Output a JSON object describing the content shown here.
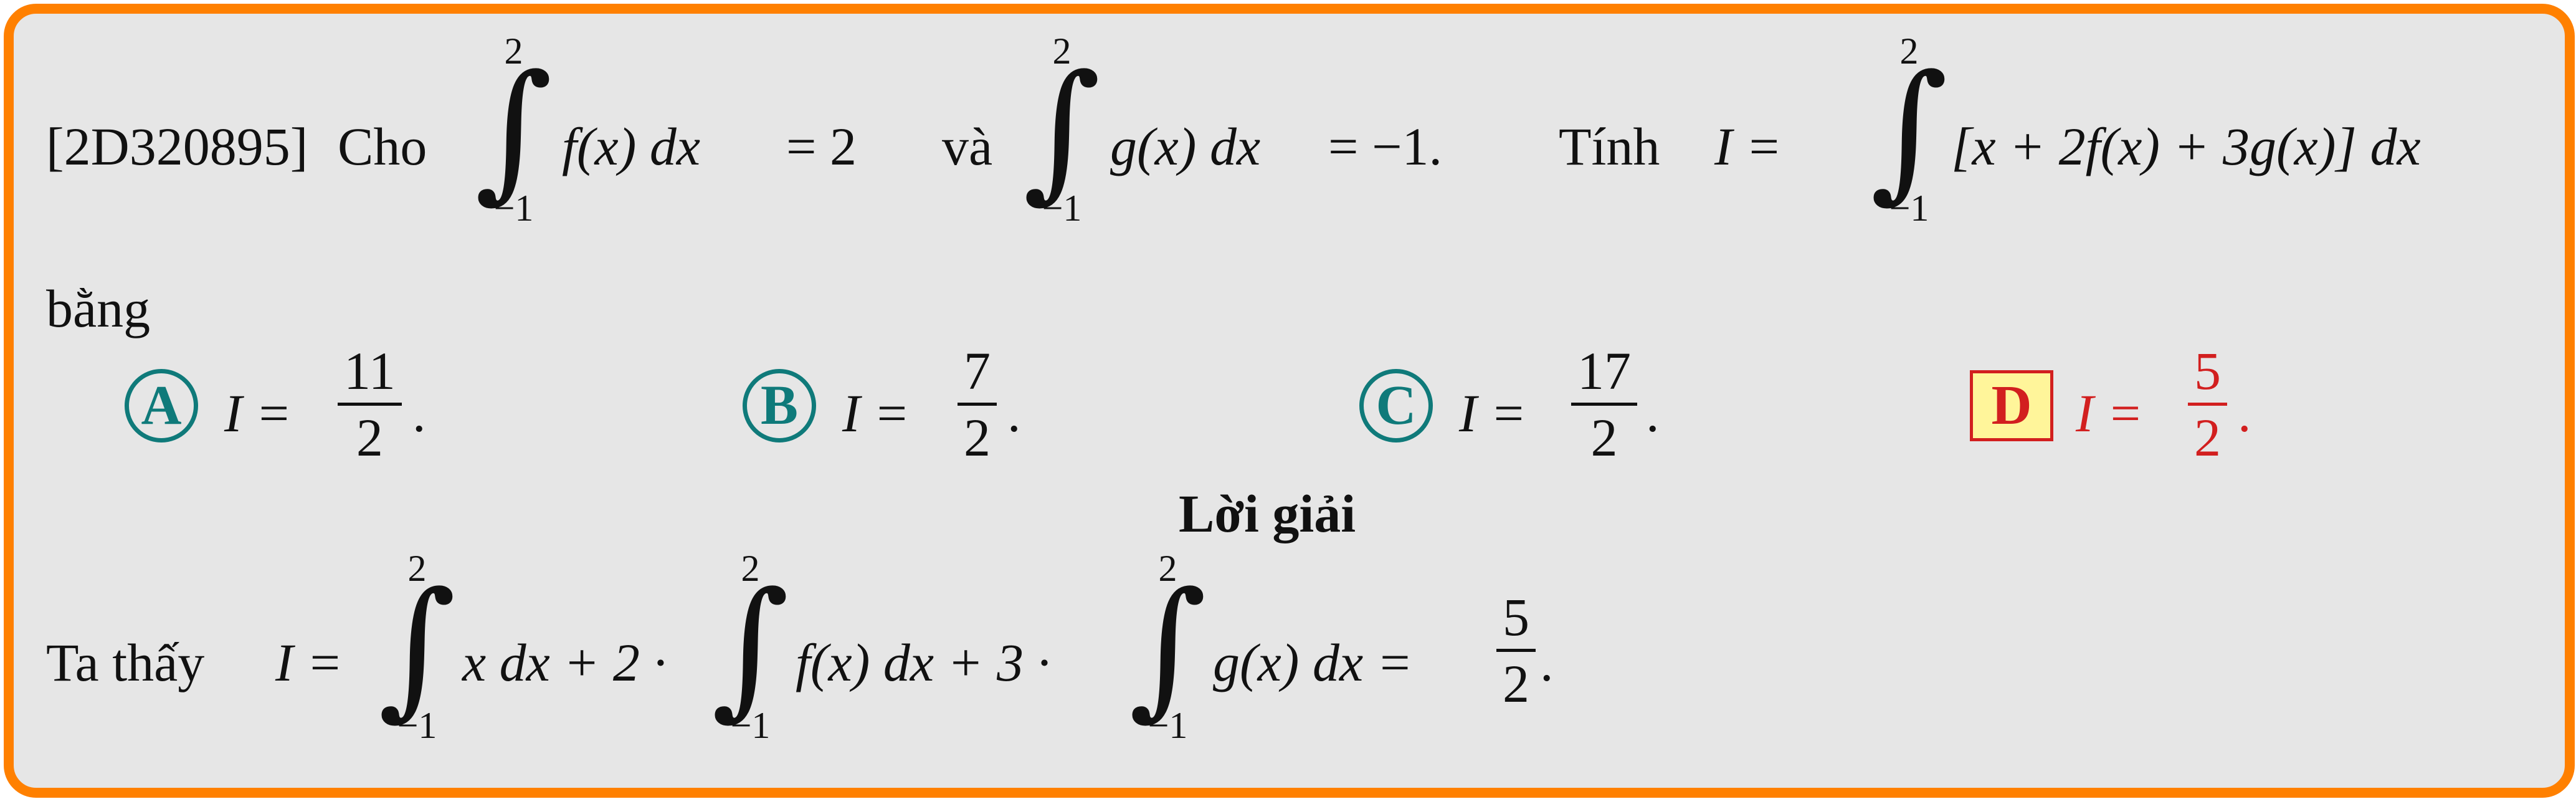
{
  "question": {
    "code": "[2D320895]",
    "text_cho": "Cho",
    "text_va": "và",
    "text_tinh": "Tính",
    "text_bang": "bằng",
    "int1": {
      "upper": "2",
      "lower": "−1",
      "expr": "f(x) dx",
      "rhs": "= 2"
    },
    "int2": {
      "upper": "2",
      "lower": "−1",
      "expr": "g(x) dx",
      "rhs": "= −1."
    },
    "int3": {
      "lhs": "I =",
      "upper": "2",
      "lower": "−1",
      "expr": "[x + 2f(x) + 3g(x)] dx"
    }
  },
  "options": [
    {
      "letter": "A",
      "lhs": "I =",
      "num": "11",
      "den": "2",
      "tail": "."
    },
    {
      "letter": "B",
      "lhs": "I =",
      "num": "7",
      "den": "2",
      "tail": "."
    },
    {
      "letter": "C",
      "lhs": "I =",
      "num": "17",
      "den": "2",
      "tail": "."
    },
    {
      "letter": "D",
      "lhs": "I =",
      "num": "5",
      "den": "2",
      "tail": ".",
      "correct": true
    }
  ],
  "solution": {
    "title": "Lời giải",
    "prefix": "Ta thấy",
    "lhs": "I =",
    "int1": {
      "upper": "2",
      "lower": "−1",
      "expr": "x dx + 2 ·"
    },
    "int2": {
      "upper": "2",
      "lower": "−1",
      "expr": "f(x) dx + 3 ·"
    },
    "int3": {
      "upper": "2",
      "lower": "−1",
      "expr": "g(x) dx ="
    },
    "result": {
      "num": "5",
      "den": "2",
      "tail": "."
    }
  },
  "colors": {
    "border": "#ff8000",
    "background": "#e6e6e6",
    "option": "#0f7a7a",
    "correct": "#d21f1f",
    "correct_bg": "#fff59a"
  }
}
